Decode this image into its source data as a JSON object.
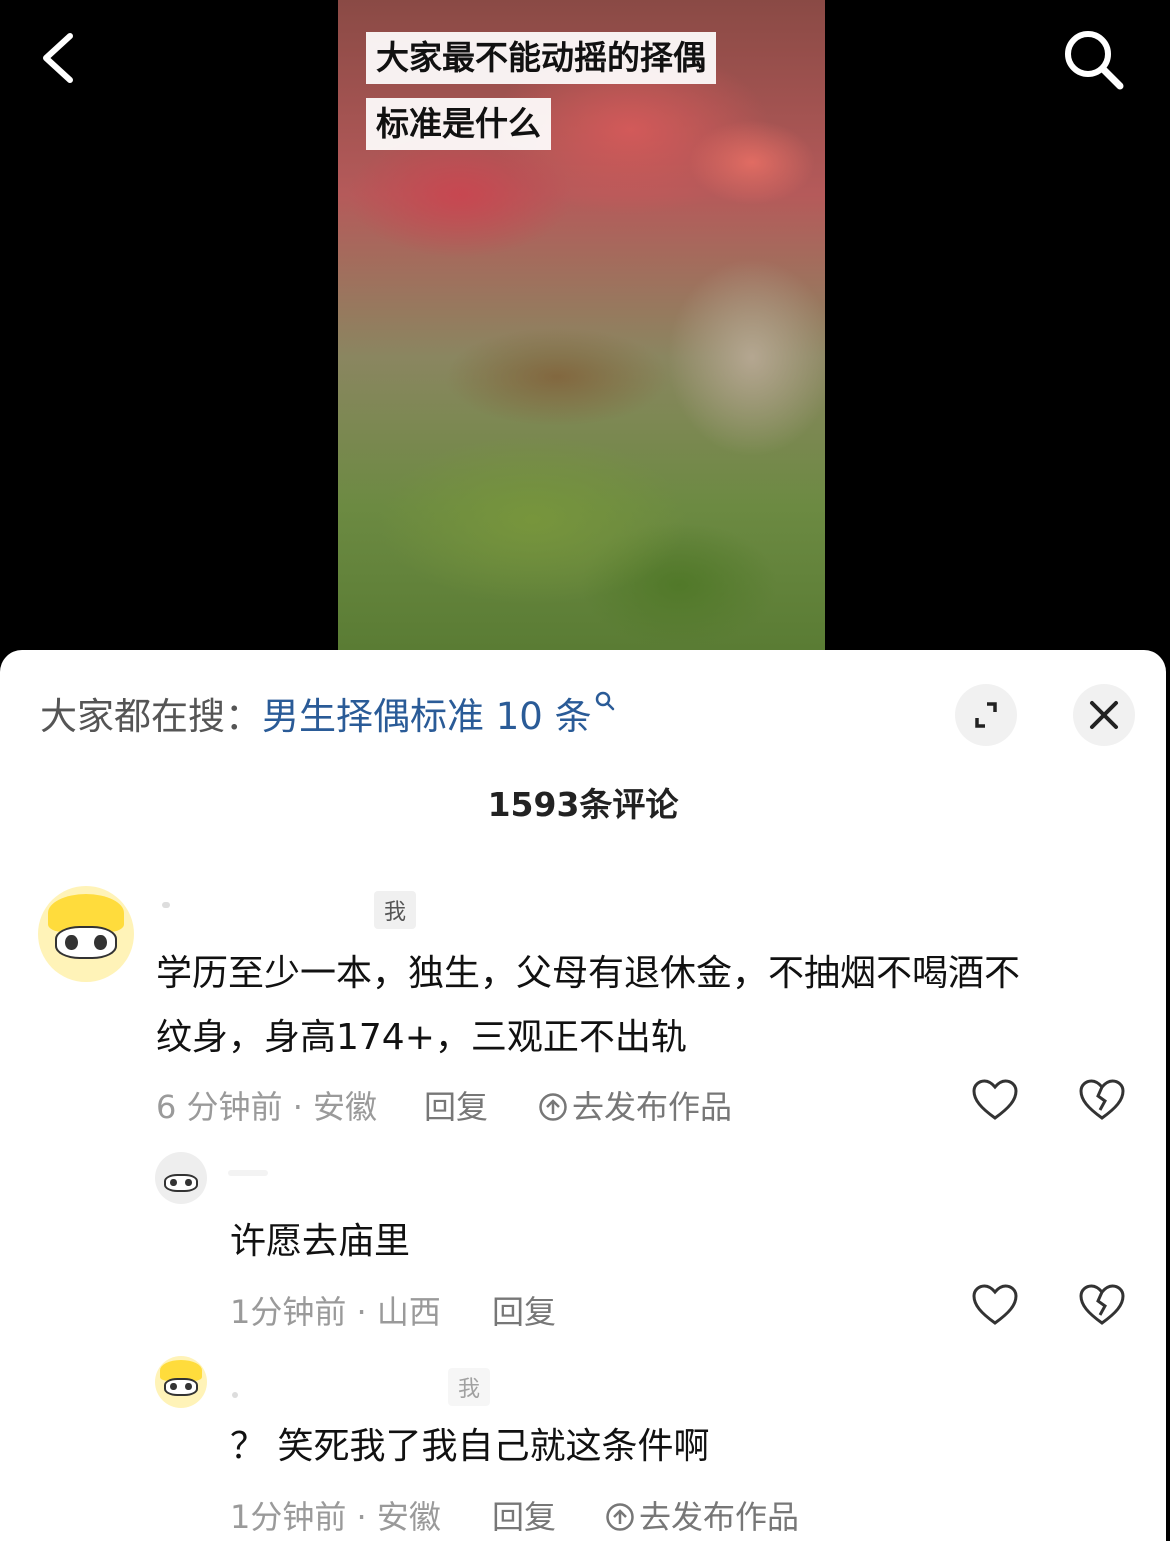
{
  "video": {
    "title_line1": "大家最不能动摇的择偶",
    "title_line2": "标准是什么"
  },
  "comments_panel": {
    "search_prefix": "大家都在搜：",
    "search_term": "男生择偶标准 10 条",
    "count_label": "1593条评论"
  },
  "comments": [
    {
      "tag": "我",
      "text_line1": "学历至少一本，独生，父母有退休金，不抽烟不喝酒不",
      "text_line2": "纹身，身高174+，三观正不出轨",
      "meta": "6 分钟前 · 安徽",
      "reply_label": "回复",
      "publish_label": "去发布作品"
    },
    {
      "text": "许愿去庙里",
      "meta": "1分钟前 · 山西",
      "reply_label": "回复"
    },
    {
      "tag": "我",
      "text": "？ 笑死我了我自己就这条件啊",
      "meta": "1分钟前 · 安徽",
      "reply_label": "回复",
      "publish_label": "去发布作品"
    }
  ],
  "icons": {
    "back": "back-arrow-icon",
    "search": "search-icon",
    "expand": "expand-icon",
    "close": "close-icon",
    "like": "heart-icon",
    "dislike": "broken-heart-icon",
    "publish": "upload-circle-icon"
  },
  "colors": {
    "search_term": "#2a5b97",
    "meta_text": "#9a9a9a",
    "background_video": "#000000"
  }
}
